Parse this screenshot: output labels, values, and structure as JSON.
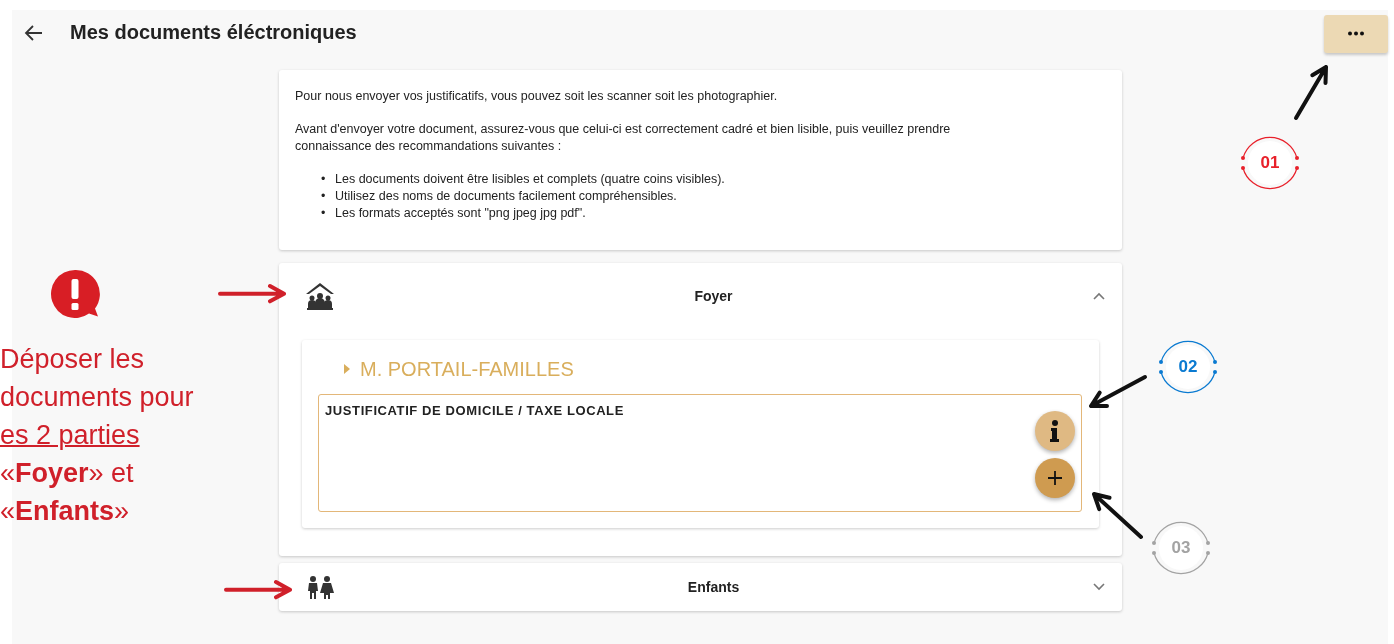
{
  "header": {
    "title": "Mes documents éléctroniques"
  },
  "info": {
    "paragraphs": [
      "Pour nous envoyer vos justificatifs, vous pouvez soit les scanner soit les photographier.",
      "Avant d'envoyer votre document, assurez-vous que celui-ci est correctement cadré et bien lisible, puis veuillez prendre connaissance des recommandations suivantes :"
    ],
    "bullets": [
      {
        "marker": "•",
        "text": "Les documents doivent être lisibles et complets (quatre coins visibles)."
      },
      {
        "marker": "•",
        "text": "Utilisez des noms de documents facilement compréhensibles."
      },
      {
        "marker": "•",
        "text": "Les formats acceptés sont \"png jpeg jpg pdf\"."
      }
    ]
  },
  "sections": [
    {
      "title": "Foyer",
      "kind": "household",
      "expanded": true,
      "persons": [
        {
          "name": "M. PORTAIL-FAMILLES",
          "documents": [
            {
              "title": "JUSTIFICATIF DE DOMICILE / TAXE LOCALE"
            }
          ]
        }
      ]
    },
    {
      "title": "Enfants",
      "kind": "children",
      "expanded": false
    }
  ],
  "annotation": {
    "note_lines": [
      {
        "text": "Déposer les",
        "underlined": false
      },
      {
        "text": "documents pour",
        "underlined": false
      },
      {
        "text": "es 2 parties",
        "underlined": true
      },
      {
        "text": "«**Foyer**» et",
        "underlined": false
      },
      {
        "text": "«**Enfants**»",
        "underlined": false
      }
    ],
    "callouts": [
      {
        "label": "01",
        "color": "#e8202a"
      },
      {
        "label": "02",
        "color": "#0a7ad1"
      },
      {
        "label": "03",
        "color": "#a3a3a3"
      }
    ]
  }
}
